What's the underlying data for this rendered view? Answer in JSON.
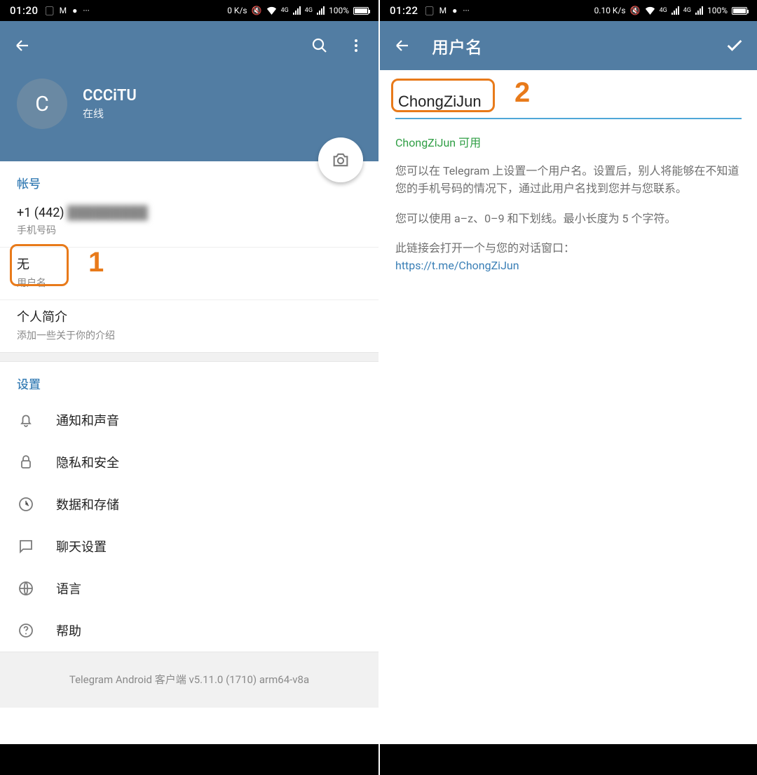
{
  "left": {
    "status": {
      "time": "01:20",
      "net_speed": "0 K/s",
      "battery": "100%",
      "net_label": "4G"
    },
    "profile": {
      "avatar_letter": "C",
      "name": "CCCiTU",
      "status": "在线"
    },
    "account": {
      "section_title": "帐号",
      "phone_prefix": "+1 (442)",
      "phone_label": "手机号码",
      "username_value": "无",
      "username_label": "用户名",
      "bio_title": "个人简介",
      "bio_hint": "添加一些关于你的介绍"
    },
    "settings": {
      "section_title": "设置",
      "items": [
        {
          "icon": "bell-icon",
          "label": "通知和声音"
        },
        {
          "icon": "lock-icon",
          "label": "隐私和安全"
        },
        {
          "icon": "clock-icon",
          "label": "数据和存储"
        },
        {
          "icon": "chat-icon",
          "label": "聊天设置"
        },
        {
          "icon": "globe-icon",
          "label": "语言"
        },
        {
          "icon": "help-icon",
          "label": "帮助"
        }
      ]
    },
    "version": "Telegram Android 客户端 v5.11.0 (1710) arm64-v8a",
    "annotation_num": "1"
  },
  "right": {
    "status": {
      "time": "01:22",
      "net_speed": "0.10 K/s",
      "battery": "100%",
      "net_label": "4G"
    },
    "appbar_title": "用户名",
    "username_value": "ChongZiJun",
    "available_text": "ChongZiJun 可用",
    "desc1": "您可以在 Telegram 上设置一个用户名。设置后，别人将能够在不知道您的手机号码的情况下，通过此用户名找到您并与您联系。",
    "desc2": "您可以使用 a–z、0–9 和下划线。最小长度为 5 个字符。",
    "desc3": "此链接会打开一个与您的对话窗口：",
    "link": "https://t.me/ChongZiJun",
    "annotation_num": "2"
  }
}
